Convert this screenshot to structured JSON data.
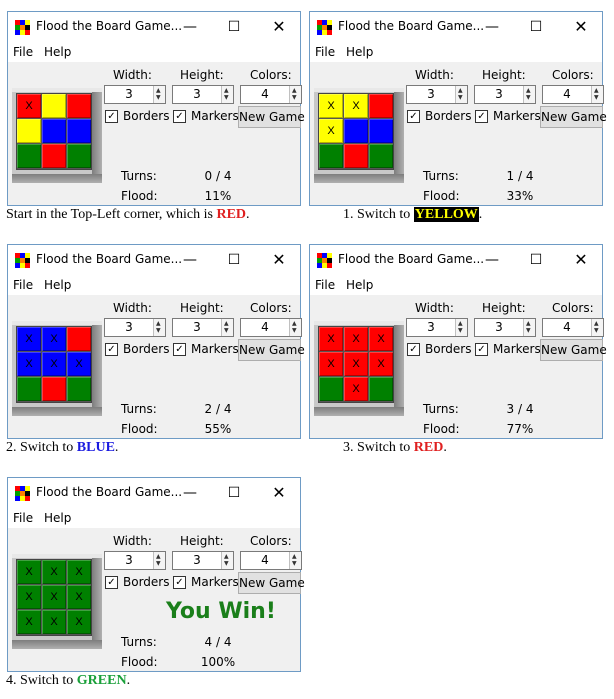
{
  "app": {
    "title": "Flood the Board Game...",
    "menu": [
      "File",
      "Help"
    ],
    "window_buttons": {
      "minimize": "—",
      "maximize": "☐",
      "close": "✕"
    },
    "labels": {
      "width": "Width:",
      "height": "Height:",
      "colors": "Colors:",
      "borders": "Borders",
      "markers": "Markers",
      "new_game": "New Game",
      "turns": "Turns:",
      "flood": "Flood:"
    },
    "spinners": {
      "width": "3",
      "height": "3",
      "colors": "4"
    },
    "checkbox_mark": "✓",
    "marker": "X"
  },
  "colors": {
    "red": "#ff0000",
    "yellow": "#ffff00",
    "blue": "#0000ff",
    "green": "#008000"
  },
  "windows": [
    {
      "board": [
        [
          "red",
          "yellow",
          "red"
        ],
        [
          "yellow",
          "blue",
          "blue"
        ],
        [
          "green",
          "red",
          "green"
        ]
      ],
      "markers": [
        [
          true,
          false,
          false
        ],
        [
          false,
          false,
          false
        ],
        [
          false,
          false,
          false
        ]
      ],
      "turns": "0 / 4",
      "flood": "11%",
      "win_text": "",
      "caption": {
        "prefix": "Start in the Top-Left corner, which is ",
        "keyword": "RED",
        "keyword_color": "red",
        "suffix": "."
      }
    },
    {
      "board": [
        [
          "yellow",
          "yellow",
          "red"
        ],
        [
          "yellow",
          "blue",
          "blue"
        ],
        [
          "green",
          "red",
          "green"
        ]
      ],
      "markers": [
        [
          true,
          true,
          false
        ],
        [
          true,
          false,
          false
        ],
        [
          false,
          false,
          false
        ]
      ],
      "turns": "1 / 4",
      "flood": "33%",
      "win_text": "",
      "caption": {
        "prefix": "1. Switch to ",
        "keyword": "YELLOW",
        "keyword_color": "yellow",
        "suffix": "."
      }
    },
    {
      "board": [
        [
          "blue",
          "blue",
          "red"
        ],
        [
          "blue",
          "blue",
          "blue"
        ],
        [
          "green",
          "red",
          "green"
        ]
      ],
      "markers": [
        [
          true,
          true,
          false
        ],
        [
          true,
          true,
          true
        ],
        [
          false,
          false,
          false
        ]
      ],
      "turns": "2 / 4",
      "flood": "55%",
      "win_text": "",
      "caption": {
        "prefix": "2. Switch to ",
        "keyword": "BLUE",
        "keyword_color": "blue",
        "suffix": "."
      }
    },
    {
      "board": [
        [
          "red",
          "red",
          "red"
        ],
        [
          "red",
          "red",
          "red"
        ],
        [
          "green",
          "red",
          "green"
        ]
      ],
      "markers": [
        [
          true,
          true,
          true
        ],
        [
          true,
          true,
          true
        ],
        [
          false,
          true,
          false
        ]
      ],
      "turns": "3 / 4",
      "flood": "77%",
      "win_text": "",
      "caption": {
        "prefix": "3. Switch to ",
        "keyword": "RED",
        "keyword_color": "red",
        "suffix": "."
      }
    },
    {
      "board": [
        [
          "green",
          "green",
          "green"
        ],
        [
          "green",
          "green",
          "green"
        ],
        [
          "green",
          "green",
          "green"
        ]
      ],
      "markers": [
        [
          true,
          true,
          true
        ],
        [
          true,
          true,
          true
        ],
        [
          true,
          true,
          true
        ]
      ],
      "turns": "4 / 4",
      "flood": "100%",
      "win_text": "You Win!",
      "caption": {
        "prefix": "4. Switch to ",
        "keyword": "GREEN",
        "keyword_color": "green",
        "suffix": "."
      }
    }
  ]
}
